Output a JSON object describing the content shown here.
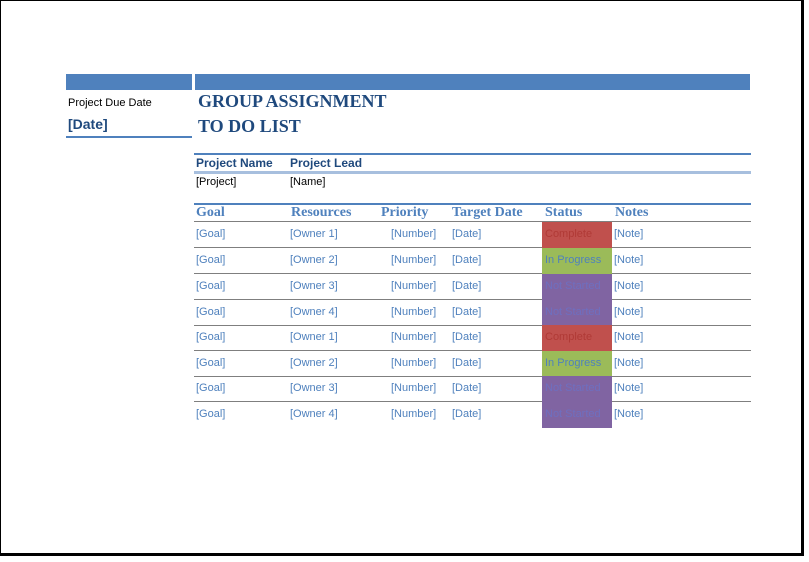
{
  "sidebar": {
    "due_label": "Project Due Date",
    "due_value": "[Date]"
  },
  "title": {
    "line1": "GROUP ASSIGNMENT",
    "line2": "TO DO LIST"
  },
  "project": {
    "name_header": "Project Name",
    "lead_header": "Project Lead",
    "name_value": "[Project]",
    "lead_value": "[Name]"
  },
  "table": {
    "columns": [
      "Goal",
      "Resources",
      "Priority",
      "Target Date",
      "Status",
      "Notes"
    ],
    "rows": [
      {
        "goal": "[Goal]",
        "resource": "[Owner 1]",
        "priority": "[Number]",
        "date": "[Date]",
        "status": "Complete",
        "status_color": "#C0504D",
        "status_text_color": "#B03A36",
        "note": "[Note]"
      },
      {
        "goal": "[Goal]",
        "resource": "[Owner 2]",
        "priority": "[Number]",
        "date": "[Date]",
        "status": "In Progress",
        "status_color": "#9BBB59",
        "status_text_color": "#4F81BD",
        "note": "[Note]"
      },
      {
        "goal": "[Goal]",
        "resource": "[Owner 3]",
        "priority": "[Number]",
        "date": "[Date]",
        "status": "Not Started",
        "status_color": "#8064A2",
        "status_text_color": "#6E6FC0",
        "note": "[Note]"
      },
      {
        "goal": "[Goal]",
        "resource": "[Owner 4]",
        "priority": "[Number]",
        "date": "[Date]",
        "status": "Not Started",
        "status_color": "#8064A2",
        "status_text_color": "#6E6FC0",
        "note": "[Note]"
      },
      {
        "goal": "[Goal]",
        "resource": "[Owner 1]",
        "priority": "[Number]",
        "date": "[Date]",
        "status": "Complete",
        "status_color": "#C0504D",
        "status_text_color": "#B03A36",
        "note": "[Note]"
      },
      {
        "goal": "[Goal]",
        "resource": "[Owner 2]",
        "priority": "[Number]",
        "date": "[Date]",
        "status": "In Progress",
        "status_color": "#9BBB59",
        "status_text_color": "#4F81BD",
        "note": "[Note]"
      },
      {
        "goal": "[Goal]",
        "resource": "[Owner 3]",
        "priority": "[Number]",
        "date": "[Date]",
        "status": "Not Started",
        "status_color": "#8064A2",
        "status_text_color": "#6E6FC0",
        "note": "[Note]"
      },
      {
        "goal": "[Goal]",
        "resource": "[Owner 4]",
        "priority": "[Number]",
        "date": "[Date]",
        "status": "Not Started",
        "status_color": "#8064A2",
        "status_text_color": "#6E6FC0",
        "note": "[Note]"
      }
    ]
  },
  "colors": {
    "accent": "#4F81BD",
    "title": "#1F497D",
    "light_rule": "#A7BFDE"
  }
}
